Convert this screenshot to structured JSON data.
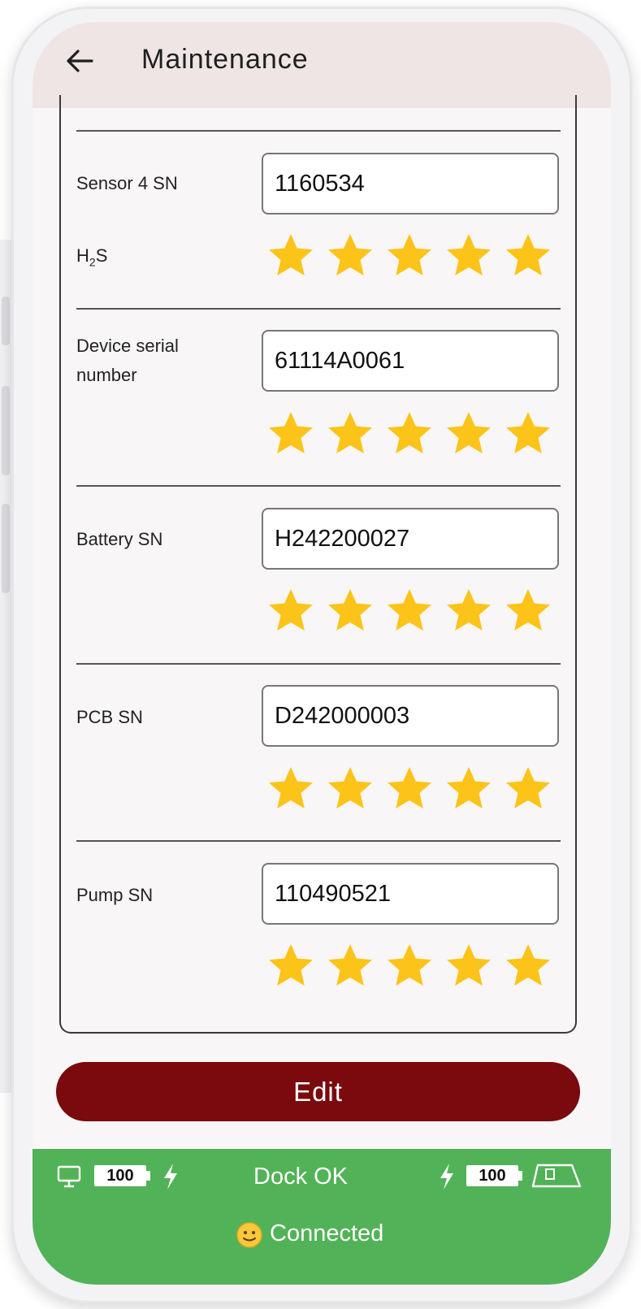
{
  "header": {
    "title": "Maintenance"
  },
  "items": [
    {
      "label": "Sensor 4 SN",
      "value": "1160534",
      "sublabel": "H",
      "sublabel_sub": "2",
      "sublabel_end": "S",
      "rating": 5
    },
    {
      "label_line1": "Device serial",
      "label_line2": "number",
      "value": "61114A0061",
      "rating": 5
    },
    {
      "label": "Battery SN",
      "value": "H242200027",
      "rating": 5
    },
    {
      "label": "PCB SN",
      "value": "D242000003",
      "rating": 5
    },
    {
      "label": "Pump SN",
      "value": "110490521",
      "rating": 5
    }
  ],
  "actions": {
    "edit_label": "Edit"
  },
  "status_bar": {
    "monitor_battery": "100",
    "dock_status": "Dock OK",
    "device_battery": "100",
    "connection_status": "Connected"
  },
  "colors": {
    "accent": "#7a0a0e",
    "status_bar": "#52b257",
    "star": "#fcc419",
    "appbar": "#efe5e5"
  },
  "icons": [
    "back-arrow-icon",
    "star-icon",
    "monitor-icon",
    "charging-bolt-icon",
    "battery-icon",
    "dock-icon",
    "smiley-icon"
  ]
}
